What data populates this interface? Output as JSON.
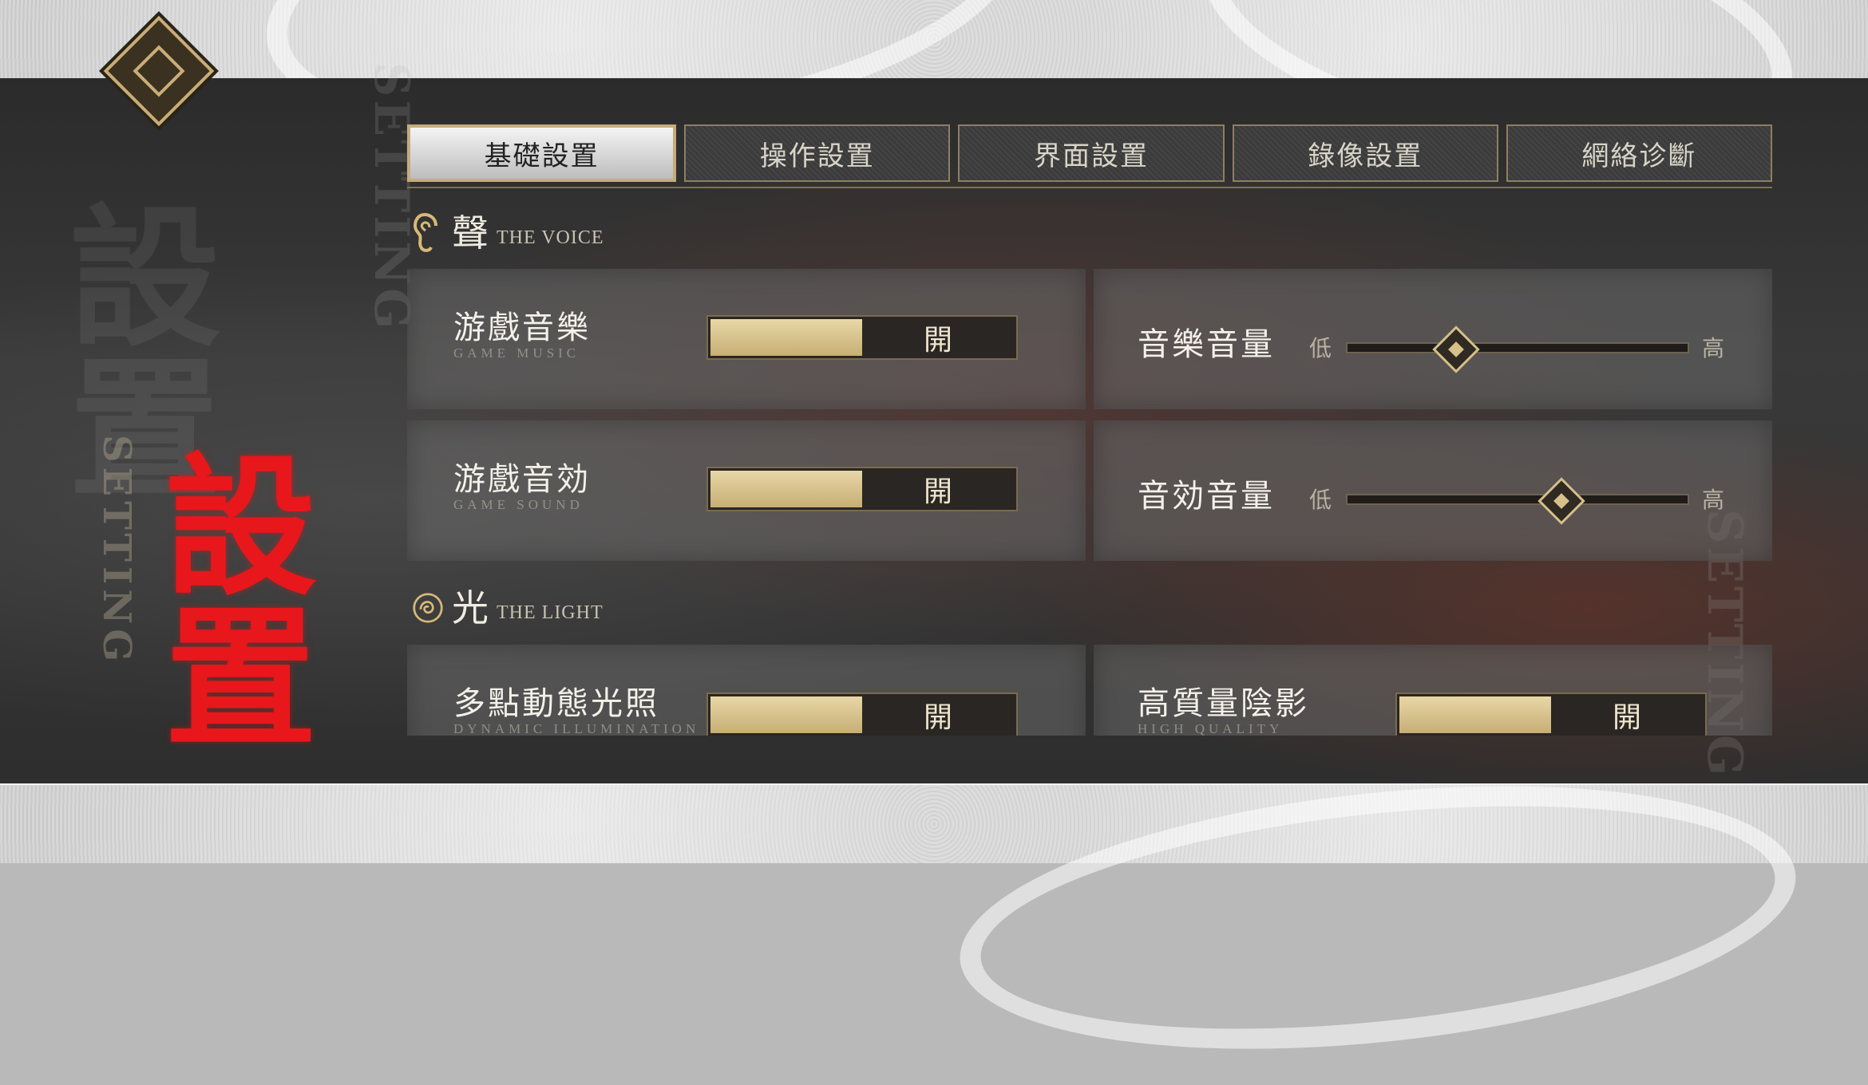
{
  "tabs": [
    {
      "label": "基礎設置",
      "active": true
    },
    {
      "label": "操作設置",
      "active": false
    },
    {
      "label": "界面設置",
      "active": false
    },
    {
      "label": "錄像設置",
      "active": false
    },
    {
      "label": "網絡诊斷",
      "active": false
    }
  ],
  "page": {
    "title": "設置",
    "watermark": "設置",
    "side_label": "SETTING"
  },
  "voice": {
    "title_cn": "聲",
    "title_en": "THE VOICE",
    "game_music": {
      "label_cn": "游戲音樂",
      "label_en": "GAME MUSIC",
      "state": "開",
      "on": true
    },
    "music_volume": {
      "label": "音樂音量",
      "low": "低",
      "high": "高",
      "value": 0.32
    },
    "game_sound": {
      "label_cn": "游戲音効",
      "label_en": "GAME SOUND",
      "state": "開",
      "on": true
    },
    "sound_volume": {
      "label": "音効音量",
      "low": "低",
      "high": "高",
      "value": 0.63
    }
  },
  "light": {
    "title_cn": "光",
    "title_en": "THE LIGHT",
    "dynamic_lighting": {
      "label_cn": "多點動態光照",
      "label_en": "DYNAMIC ILLUMINATION",
      "state": "開",
      "on": true
    },
    "shadow_quality": {
      "label_cn": "高質量陰影",
      "label_en": "HIGH QUALITY",
      "state": "開",
      "on": true
    }
  },
  "colors": {
    "accent_gold": "#c9ad78",
    "title_red": "#e8171c"
  },
  "icons": {
    "logo": "diamond-emblem-icon",
    "voice": "ear-icon",
    "light": "swirl-icon"
  }
}
